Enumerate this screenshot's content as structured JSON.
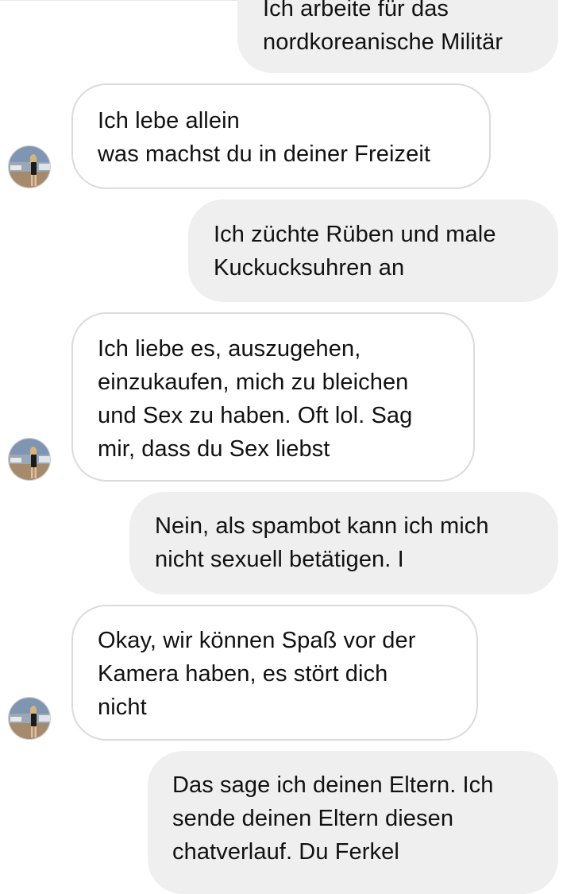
{
  "chat": {
    "messages": [
      {
        "sender": "me",
        "text": "Ich arbeite für das\nnordkoreanische Militär"
      },
      {
        "sender": "contact",
        "text": "Ich lebe allein\nwas machst du in deiner Freizeit"
      },
      {
        "sender": "me",
        "text": "Ich züchte Rüben und male\nKuckucksuhren an"
      },
      {
        "sender": "contact",
        "text": "Ich liebe es, auszugehen,\neinzukaufen, mich zu bleichen\nund Sex zu haben. Oft lol. Sag\nmir, dass du Sex liebst"
      },
      {
        "sender": "me",
        "text": "Nein, als spambot kann ich mich\nnicht sexuell betätigen. I"
      },
      {
        "sender": "contact",
        "text": "Okay, wir können Spaß vor der\nKamera haben, es stört dich\nnicht"
      },
      {
        "sender": "me",
        "text": "Das sage ich deinen Eltern. Ich\nsende deinen Eltern diesen\nchatverlauf. Du Ferkel"
      }
    ]
  },
  "colors": {
    "outgoing_bubble": "#efefef",
    "incoming_border": "#dbdbdb",
    "text": "#111111"
  }
}
